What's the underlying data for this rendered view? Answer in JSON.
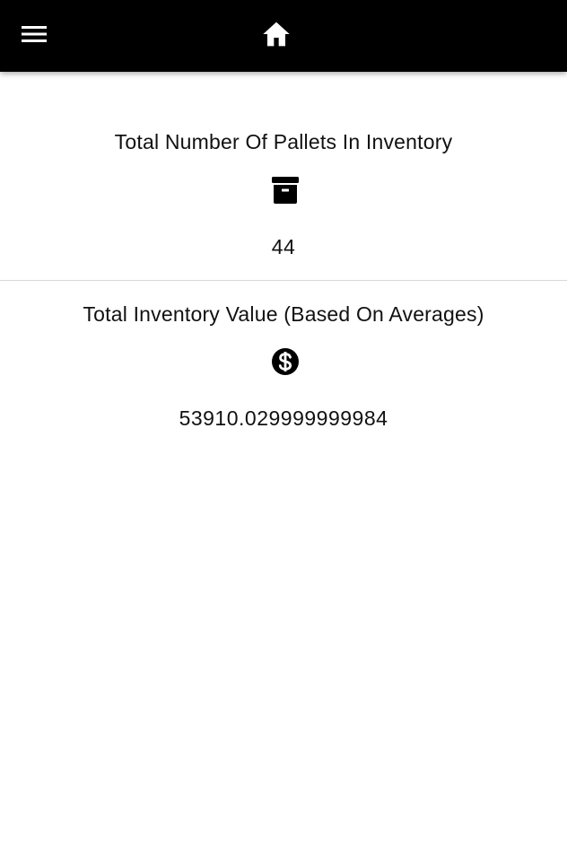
{
  "header": {
    "menu_icon": "hamburger-menu-icon",
    "home_icon": "home-icon",
    "background_color": "#000000",
    "icon_color": "#ffffff"
  },
  "stats": {
    "pallets": {
      "title": "Total Number Of Pallets In Inventory",
      "icon": "archive-box-icon",
      "value": "44"
    },
    "inventory_value": {
      "title": "Total Inventory Value (Based On Averages)",
      "icon": "dollar-circle-icon",
      "value": "53910.029999999984"
    }
  }
}
